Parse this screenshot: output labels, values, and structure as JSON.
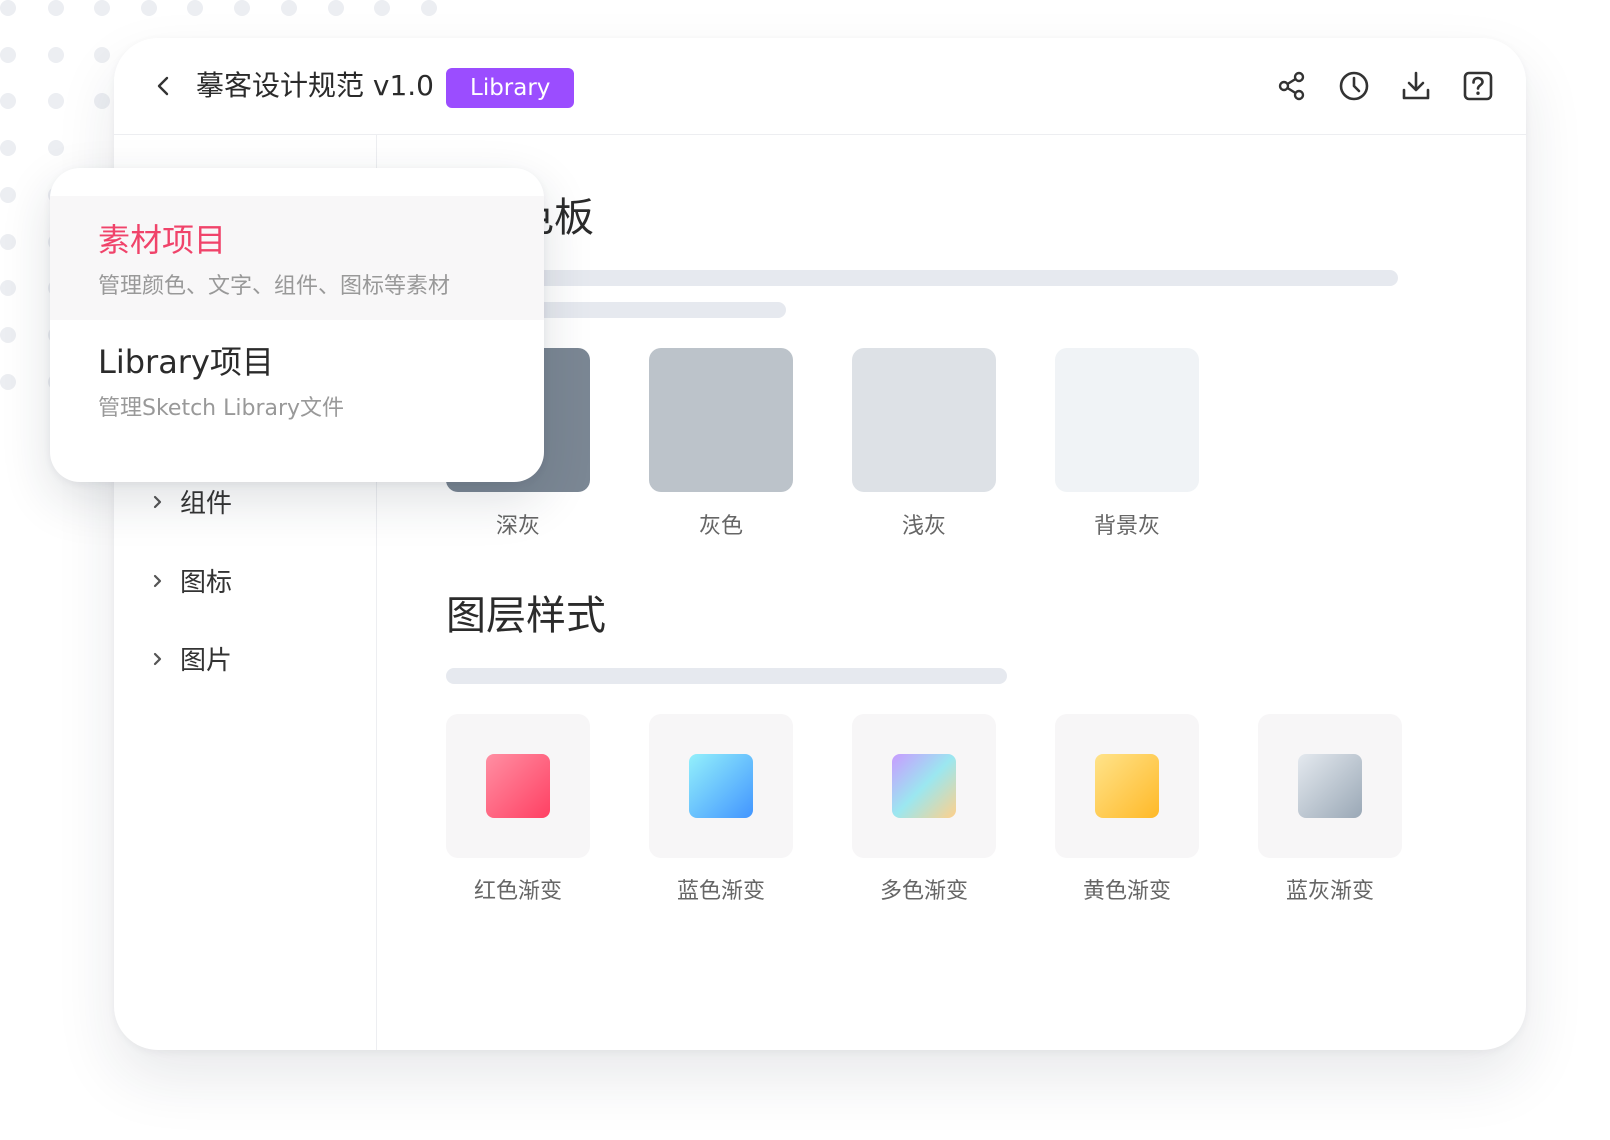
{
  "header": {
    "title": "摹客设计规范 v1.0",
    "badge": "Library"
  },
  "colors": {
    "accent": "#9b4dff",
    "active_text": "#f0436a"
  },
  "dropdown": {
    "items": [
      {
        "title": "素材项目",
        "description": "管理颜色、文字、组件、图标等素材",
        "active": true
      },
      {
        "title": "Library项目",
        "description": "管理Sketch Library文件",
        "active": false
      }
    ]
  },
  "sidebar": {
    "items": [
      {
        "label": "组件"
      },
      {
        "label": "图标"
      },
      {
        "label": "图片"
      }
    ]
  },
  "palette": {
    "title": "色板",
    "swatches": [
      {
        "label": "深灰",
        "color": "#7b8794"
      },
      {
        "label": "灰色",
        "color": "#bcc3ca"
      },
      {
        "label": "浅灰",
        "color": "#dde1e6"
      },
      {
        "label": "背景灰",
        "color": "#f0f3f6"
      }
    ]
  },
  "layer_styles": {
    "title": "图层样式",
    "items": [
      {
        "label": "红色渐变",
        "gradient": [
          "#ff8fa3",
          "#ff4063"
        ]
      },
      {
        "label": "蓝色渐变",
        "gradient": [
          "#93f0fb",
          "#4295ff"
        ]
      },
      {
        "label": "多色渐变",
        "gradient": [
          "#c89bff",
          "#9be7f0",
          "#ffd08a"
        ]
      },
      {
        "label": "黄色渐变",
        "gradient": [
          "#ffe38a",
          "#ffb928"
        ]
      },
      {
        "label": "蓝灰渐变",
        "gradient": [
          "#e4e9ef",
          "#9aa8b6"
        ]
      }
    ]
  }
}
